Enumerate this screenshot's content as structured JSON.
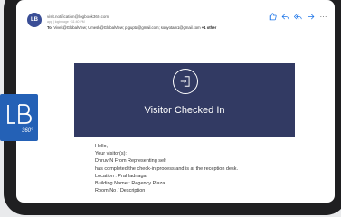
{
  "email": {
    "avatar_initials": "LB",
    "sender": "visit.notification@logbook360.com",
    "meta": "app | loginpage · 11:40 PM",
    "to_label": "To:",
    "recipients": "Vivek@GlobalView; Umesh@GlobalView; p.gupta@gmail.com; sonyotam1@gmail.com",
    "other_label": "+1 other"
  },
  "actions": {
    "like_icon": "thumbs-up-icon",
    "reply_icon": "reply-icon",
    "reply_all_icon": "reply-all-icon",
    "forward_icon": "forward-icon",
    "more_label": "···"
  },
  "banner": {
    "icon": "door-enter-icon",
    "title": "Visitor Checked In",
    "background": "#323a63"
  },
  "message_lines": [
    "Hello,",
    "Your visitor(s):",
    "Dhruv N From Representing self",
    "has completed the check-in process and is at the reception desk.",
    "Location : Prahladnagar",
    "Building Name : Regency Plaza",
    "Room No / Description :"
  ],
  "logo": {
    "text": "LB",
    "sub": "360°",
    "color": "#2461b6"
  }
}
